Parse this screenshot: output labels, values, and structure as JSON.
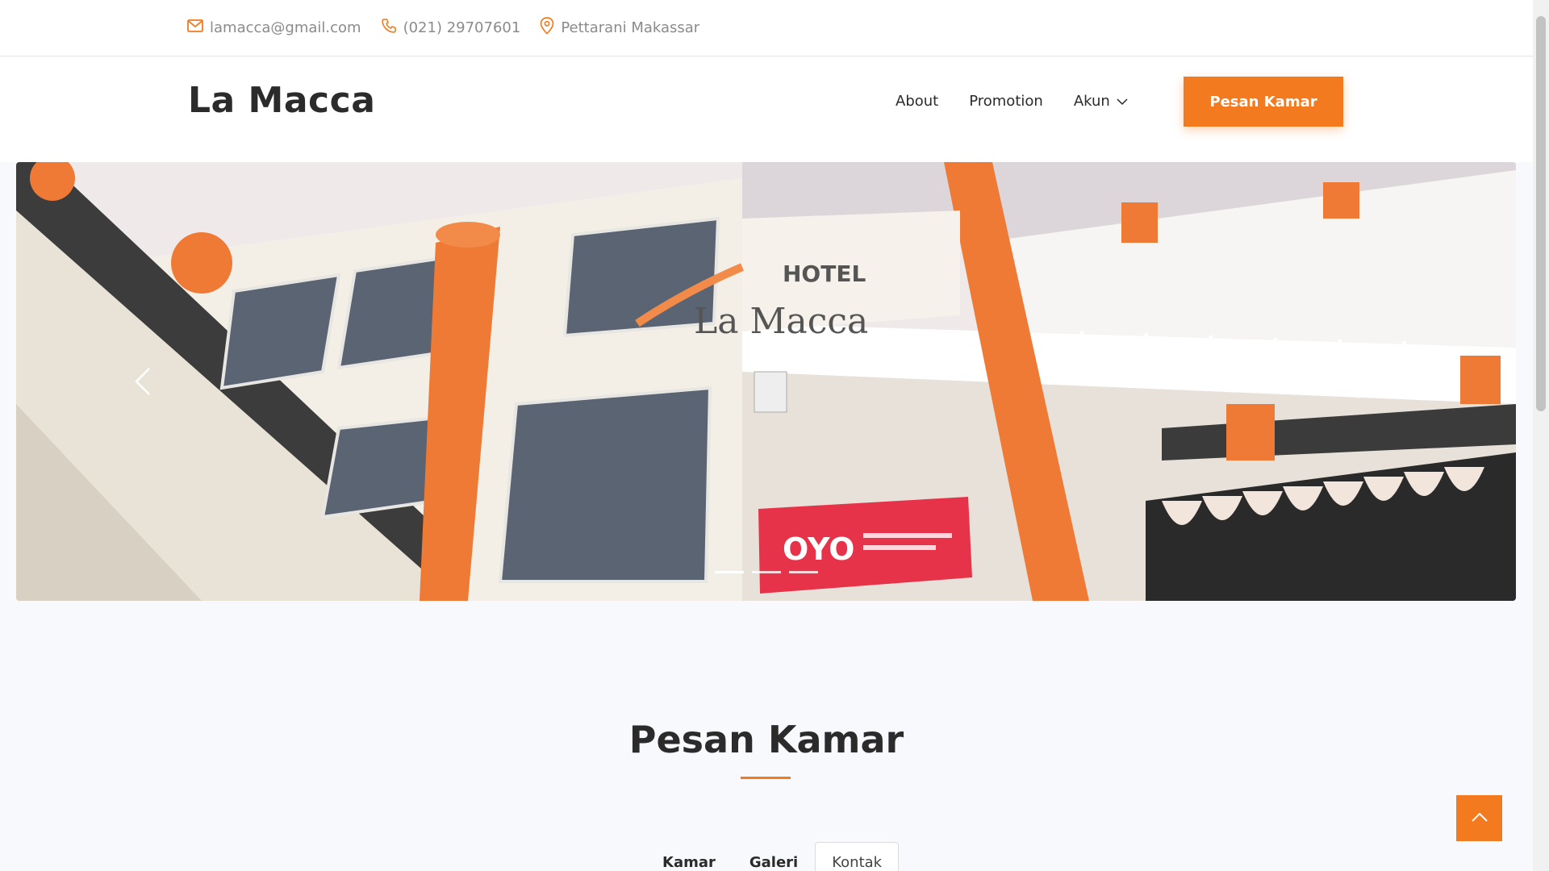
{
  "topbar": {
    "email": "lamacca@gmail.com",
    "phone": "(021) 29707601",
    "location": "Pettarani Makassar",
    "email_icon": "mail-icon",
    "phone_icon": "phone-icon",
    "location_icon": "map-pin-icon"
  },
  "header": {
    "logo": "La Macca",
    "nav": {
      "about": "About",
      "promotion": "Promotion",
      "akun": "Akun"
    },
    "cta": "Pesan Kamar"
  },
  "hero": {
    "sign_line1": "HOTEL",
    "sign_line2": "La Macca",
    "oyo": "OYO",
    "slide_count": 3,
    "active_slide": 1
  },
  "section": {
    "title": "Pesan Kamar",
    "tabs": [
      "Kamar",
      "Galeri",
      "Kontak"
    ],
    "active_tab": "Kontak"
  },
  "colors": {
    "accent": "#f47a1f",
    "text": "#2b2b2b",
    "muted": "#8b8b8b",
    "background": "#f8f9fd"
  }
}
